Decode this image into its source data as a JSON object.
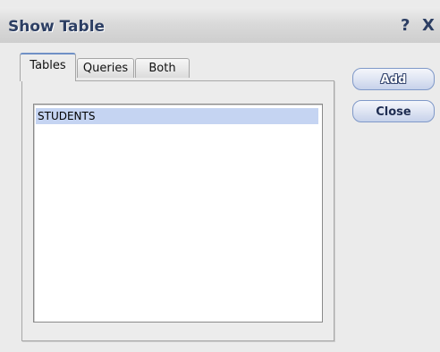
{
  "window": {
    "title": "Show Table",
    "help_label": "?",
    "close_label": "X"
  },
  "tabs": [
    {
      "label": "Tables",
      "active": true
    },
    {
      "label": "Queries",
      "active": false
    },
    {
      "label": "Both",
      "active": false
    }
  ],
  "list": {
    "items": [
      "STUDENTS"
    ],
    "selected": "STUDENTS"
  },
  "buttons": {
    "add_label": "Add",
    "close_label": "Close"
  },
  "colors": {
    "title_text": "#2c3e63",
    "selection": "#c5d4f2",
    "button_border": "#7f98c8"
  }
}
